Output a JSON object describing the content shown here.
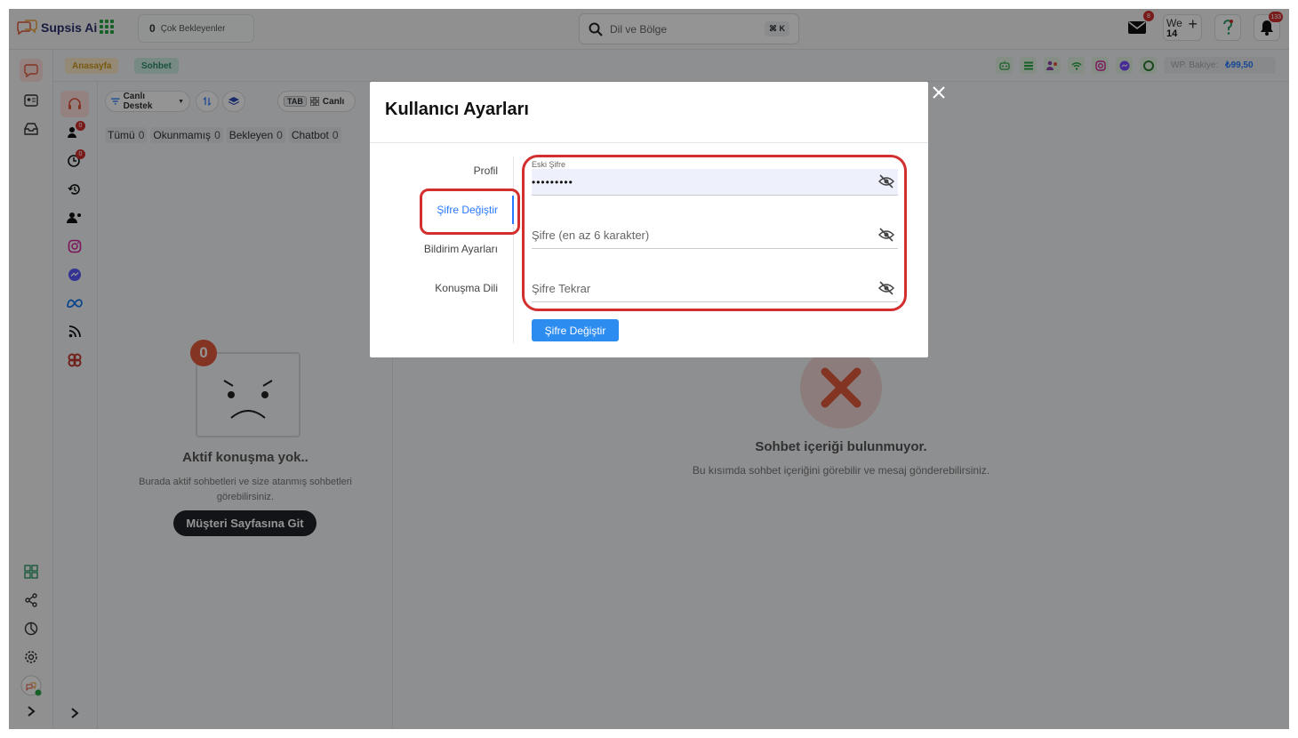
{
  "app": {
    "name": "Supsis Ai"
  },
  "topbar": {
    "waiting_count": "0",
    "waiting_label": "Çok Bekleyenler",
    "search_placeholder": "Dil ve Bölge",
    "search_shortcut": "⌘ K",
    "mail_badge": "8",
    "notif_badge": "133",
    "we_label": "We",
    "we_number": "14"
  },
  "tabs": {
    "home": "Anasayfa",
    "chat": "Sohbet"
  },
  "balance": {
    "label": "WP. Bakiye:",
    "value": "₺99,50"
  },
  "list_toolbar": {
    "live_support": "Canlı Destek",
    "tab_key": "TAB",
    "live": "Canlı"
  },
  "filters": [
    {
      "label": "Tümü",
      "count": "0"
    },
    {
      "label": "Okunmamış",
      "count": "0"
    },
    {
      "label": "Bekleyen",
      "count": "0"
    },
    {
      "label": "Chatbot",
      "count": "0"
    }
  ],
  "subnav_badges": {
    "contacts": "0",
    "chats": "0"
  },
  "empty_list": {
    "count": "0",
    "title": "Aktif konuşma yok..",
    "description": "Burada aktif sohbetleri ve size atanmış sohbetleri görebilirsiniz.",
    "button": "Müşteri Sayfasına Git"
  },
  "empty_content": {
    "title": "Sohbet içeriği bulunmuyor.",
    "description": "Bu kısımda sohbet içeriğini görebilir ve mesaj gönderebilirsiniz."
  },
  "modal": {
    "title": "Kullanıcı Ayarları",
    "nav": [
      "Profil",
      "Şifre Değiştir",
      "Bildirim Ayarları",
      "Konuşma Dili"
    ],
    "old_password_label": "Eski Şifre",
    "old_password_value": "•••••••••",
    "new_password_placeholder": "Şifre (en az 6 karakter)",
    "repeat_password_placeholder": "Şifre Tekrar",
    "submit": "Şifre Değiştir"
  },
  "colors": {
    "accent": "#2979ff",
    "danger": "#d32f2f",
    "brand": "#2b2f6e",
    "success": "#28a745"
  }
}
